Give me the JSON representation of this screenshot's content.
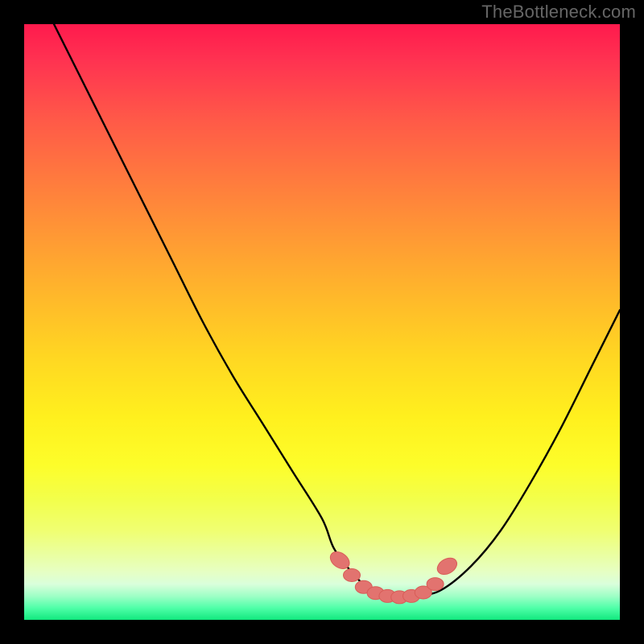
{
  "watermark": "TheBottleneck.com",
  "colors": {
    "background": "#000000",
    "curve": "#000000",
    "marker_fill": "#e2736f",
    "marker_stroke": "#d85c57"
  },
  "chart_data": {
    "type": "line",
    "title": "",
    "xlabel": "",
    "ylabel": "",
    "xlim": [
      0,
      100
    ],
    "ylim": [
      0,
      100
    ],
    "grid": false,
    "legend": false,
    "series": [
      {
        "name": "bottleneck-curve",
        "x": [
          5,
          10,
          15,
          20,
          25,
          30,
          35,
          40,
          45,
          50,
          52,
          55,
          58,
          60,
          63,
          66,
          70,
          75,
          80,
          85,
          90,
          95,
          100
        ],
        "y": [
          100,
          90,
          80,
          70,
          60,
          50,
          41,
          33,
          25,
          17,
          12,
          8,
          5,
          4,
          3.8,
          4,
          5,
          9,
          15,
          23,
          32,
          42,
          52
        ]
      }
    ],
    "markers": [
      {
        "x": 53,
        "y": 10
      },
      {
        "x": 55,
        "y": 7.5
      },
      {
        "x": 57,
        "y": 5.5
      },
      {
        "x": 59,
        "y": 4.5
      },
      {
        "x": 61,
        "y": 4
      },
      {
        "x": 63,
        "y": 3.8
      },
      {
        "x": 65,
        "y": 4
      },
      {
        "x": 67,
        "y": 4.6
      },
      {
        "x": 69,
        "y": 6
      },
      {
        "x": 71,
        "y": 9
      }
    ],
    "gradient_stops": [
      {
        "pct": 0,
        "color": "#ff1a4d"
      },
      {
        "pct": 50,
        "color": "#ffd020"
      },
      {
        "pct": 85,
        "color": "#f2ff5a"
      },
      {
        "pct": 100,
        "color": "#12e87e"
      }
    ]
  }
}
